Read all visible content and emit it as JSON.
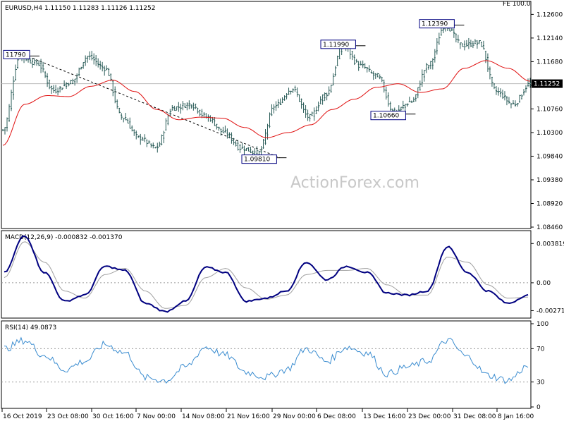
{
  "chart_data": [
    {
      "type": "candlestick",
      "title": "EURUSD,H4  1.11150 1.11283 1.11126 1.11252",
      "corner_label": "FE 100.0",
      "watermark": "ActionForex.com",
      "ylim": [
        1.0846,
        1.1277
      ],
      "y_ticks": [
        "1.12600",
        "1.12140",
        "1.11680",
        "1.11220",
        "1.10760",
        "1.10300",
        "1.09840",
        "1.09380",
        "1.08920",
        "1.08460"
      ],
      "current_price": "1.11252",
      "price_anchors": [
        1.1035,
        1.1178,
        1.1165,
        1.1112,
        1.1128,
        1.1178,
        1.1155,
        1.106,
        1.102,
        1.1,
        1.1078,
        1.1085,
        1.106,
        1.103,
        1.1,
        1.099,
        1.1082,
        1.1115,
        1.106,
        1.1105,
        1.1199,
        1.116,
        1.114,
        1.107,
        1.109,
        1.116,
        1.1239,
        1.12,
        1.1205,
        1.111,
        1.1085,
        1.1125
      ],
      "ma_anchors": [
        1.1005,
        1.1085,
        1.1102,
        1.11,
        1.112,
        1.1132,
        1.111,
        1.1075,
        1.1055,
        1.106,
        1.1058,
        1.104,
        1.102,
        1.103,
        1.1045,
        1.1075,
        1.1095,
        1.1118,
        1.1125,
        1.1108,
        1.1115,
        1.1155,
        1.117,
        1.1155,
        1.113
      ],
      "annotations": [
        {
          "label": "11790",
          "value": 1.1179
        },
        {
          "label": "1.09810",
          "value": 1.0981
        },
        {
          "label": "1.11990",
          "value": 1.1199
        },
        {
          "label": "1.10660",
          "value": 1.1066
        },
        {
          "label": "1.12390",
          "value": 1.1239
        }
      ]
    },
    {
      "type": "line",
      "title": "MACD(12,26,9) -0.000832 -0.001370",
      "y_ticks": [
        "0.003819",
        "0.00",
        "-0.002713"
      ],
      "ylim": [
        -0.0033,
        0.0048
      ],
      "macd_anchors": [
        0.001,
        0.0046,
        0.001,
        -0.0018,
        -0.0012,
        0.0016,
        0.0012,
        -0.002,
        -0.0028,
        -0.0018,
        0.0015,
        0.001,
        -0.0018,
        -0.0015,
        -0.0008,
        0.002,
        0.0003,
        0.0016,
        0.001,
        -0.001,
        -0.0012,
        -0.0008,
        0.0035,
        0.001,
        -0.0008,
        -0.002,
        -0.0012
      ],
      "signal_anchors": [
        0.0005,
        0.004,
        0.002,
        -0.0008,
        -0.0015,
        0.0008,
        0.0014,
        -0.0008,
        -0.0025,
        -0.0022,
        0.0005,
        0.0014,
        -0.0005,
        -0.0016,
        -0.0012,
        0.0008,
        0.0012,
        0.0012,
        0.0014,
        -0.0002,
        -0.0012,
        -0.0012,
        0.0025,
        0.002,
        -0.0002,
        -0.0015,
        -0.0014
      ]
    },
    {
      "type": "line",
      "title": "RSI(14) 49.0873",
      "y_ticks": [
        "100",
        "70",
        "30",
        "0"
      ],
      "ylim": [
        0,
        100
      ],
      "levels": [
        70,
        30
      ],
      "rsi_anchors": [
        70,
        80,
        62,
        45,
        55,
        75,
        65,
        35,
        32,
        48,
        72,
        62,
        42,
        36,
        45,
        70,
        55,
        72,
        65,
        40,
        48,
        55,
        80,
        60,
        38,
        32,
        49
      ]
    }
  ],
  "x_ticks": [
    "16 Oct 2019",
    "23 Oct 08:00",
    "30 Oct 16:00",
    "7 Nov 00:00",
    "14 Nov 08:00",
    "21 Nov 16:00",
    "29 Nov 00:00",
    "6 Dec 08:00",
    "13 Dec 16:00",
    "23 Dec 00:00",
    "31 Dec 08:00",
    "8 Jan 16:00"
  ],
  "colors": {
    "candle": "#2a5c58",
    "ma": "#e01010",
    "macd": "#000080",
    "signal": "#a0a0a0",
    "rsi": "#3a8cd0",
    "grid": "#bbbbbb",
    "label_bg": "#ffffff",
    "label_border": "#000080"
  }
}
